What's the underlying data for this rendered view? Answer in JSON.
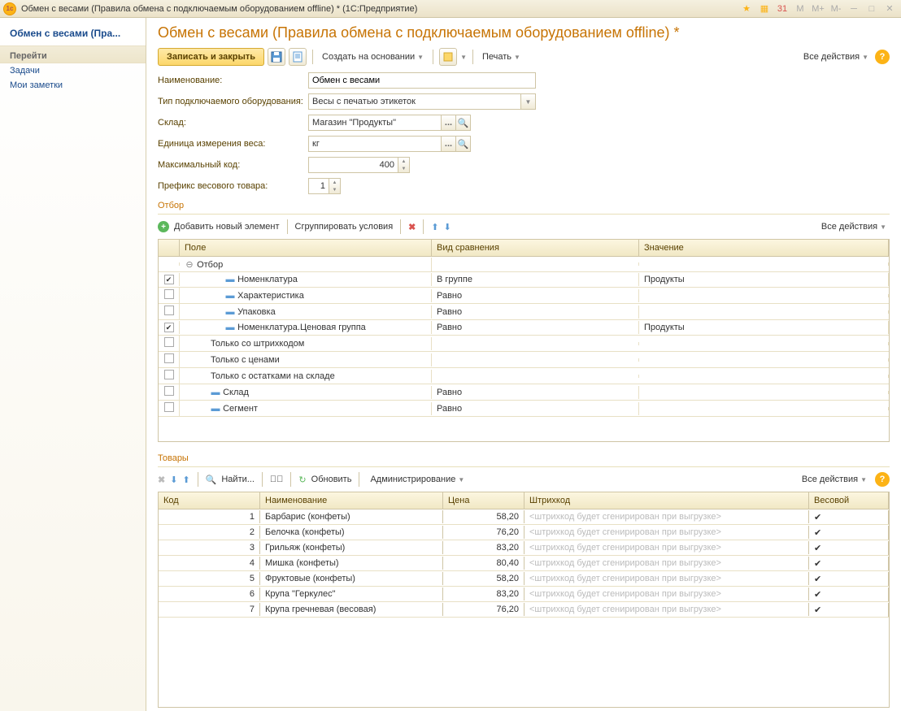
{
  "window": {
    "title": "Обмен с весами (Правила обмена с подключаемым оборудованием offline) *  (1С:Предприятие)"
  },
  "sidebar": {
    "title": "Обмен с весами (Пра...",
    "section": "Перейти",
    "links": [
      "Задачи",
      "Мои заметки"
    ]
  },
  "page": {
    "title": "Обмен с весами (Правила обмена с подключаемым оборудованием offline) *"
  },
  "toolbar": {
    "save_close": "Записать и закрыть",
    "create_based": "Создать на основании",
    "print": "Печать",
    "all_actions": "Все действия"
  },
  "form": {
    "name_label": "Наименование:",
    "name_value": "Обмен с весами",
    "type_label": "Тип подключаемого оборудования:",
    "type_value": "Весы с печатью этикеток",
    "warehouse_label": "Склад:",
    "warehouse_value": "Магазин \"Продукты\"",
    "unit_label": "Единица измерения веса:",
    "unit_value": "кг",
    "maxcode_label": "Максимальный код:",
    "maxcode_value": "400",
    "prefix_label": "Префикс весового товара:",
    "prefix_value": "1"
  },
  "filter": {
    "title": "Отбор",
    "add": "Добавить новый элемент",
    "group": "Сгруппировать условия",
    "headers": {
      "field": "Поле",
      "cmp": "Вид сравнения",
      "val": "Значение"
    },
    "root": "Отбор",
    "rows": [
      {
        "checked": true,
        "dash": true,
        "indent": 2,
        "field": "Номенклатура",
        "cmp": "В группе",
        "val": "Продукты"
      },
      {
        "checked": false,
        "dash": true,
        "indent": 2,
        "field": "Характеристика",
        "cmp": "Равно",
        "val": ""
      },
      {
        "checked": false,
        "dash": true,
        "indent": 2,
        "field": "Упаковка",
        "cmp": "Равно",
        "val": ""
      },
      {
        "checked": true,
        "dash": true,
        "indent": 2,
        "field": "Номенклатура.Ценовая группа",
        "cmp": "Равно",
        "val": "Продукты"
      },
      {
        "checked": false,
        "dash": false,
        "indent": 1,
        "field": "Только со штрихкодом",
        "cmp": "",
        "val": ""
      },
      {
        "checked": false,
        "dash": false,
        "indent": 1,
        "field": "Только с ценами",
        "cmp": "",
        "val": ""
      },
      {
        "checked": false,
        "dash": false,
        "indent": 1,
        "field": "Только с остатками на складе",
        "cmp": "",
        "val": ""
      },
      {
        "checked": false,
        "dash": true,
        "indent": 1,
        "field": "Склад",
        "cmp": "Равно",
        "val": ""
      },
      {
        "checked": false,
        "dash": true,
        "indent": 1,
        "field": "Сегмент",
        "cmp": "Равно",
        "val": ""
      }
    ]
  },
  "goods": {
    "title": "Товары",
    "find": "Найти...",
    "refresh": "Обновить",
    "admin": "Администрирование",
    "headers": {
      "code": "Код",
      "name": "Наименование",
      "price": "Цена",
      "barcode": "Штрихкод",
      "weight": "Весовой"
    },
    "barcode_placeholder": "<штрихкод будет сгенирирован при выгрузке>",
    "rows": [
      {
        "code": "1",
        "name": "Барбарис (конфеты)",
        "price": "58,20",
        "weight": true
      },
      {
        "code": "2",
        "name": "Белочка (конфеты)",
        "price": "76,20",
        "weight": true
      },
      {
        "code": "3",
        "name": "Грильяж (конфеты)",
        "price": "83,20",
        "weight": true
      },
      {
        "code": "4",
        "name": "Мишка (конфеты)",
        "price": "80,40",
        "weight": true
      },
      {
        "code": "5",
        "name": "Фруктовые (конфеты)",
        "price": "58,20",
        "weight": true
      },
      {
        "code": "6",
        "name": "Крупа \"Геркулес\"",
        "price": "83,20",
        "weight": true
      },
      {
        "code": "7",
        "name": "Крупа гречневая (весовая)",
        "price": "76,20",
        "weight": true
      }
    ]
  }
}
